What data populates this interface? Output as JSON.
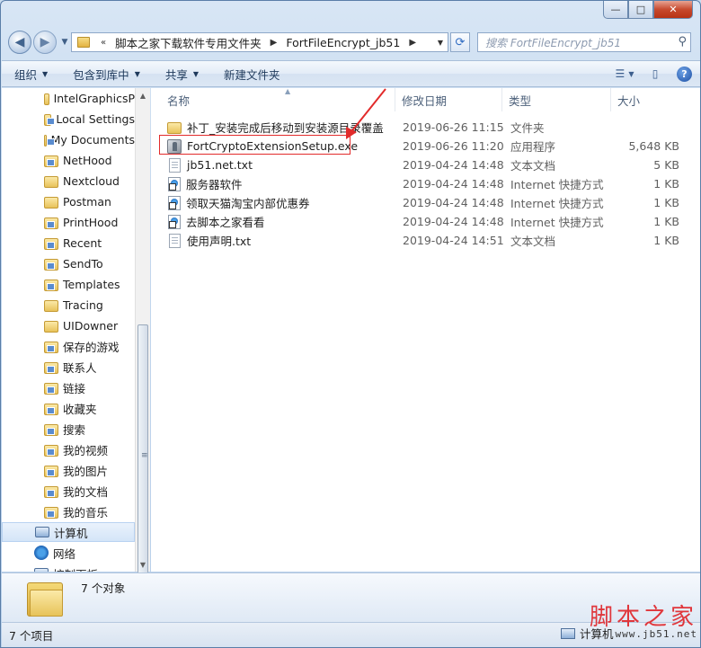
{
  "window": {
    "caption": {
      "minimize": "—",
      "maximize": "□",
      "close": "✕"
    }
  },
  "address": {
    "overflow": "«",
    "crumbs": [
      "脚本之家下载软件专用文件夹",
      "FortFileEncrypt_jb51"
    ],
    "search_placeholder": "搜索 FortFileEncrypt_jb51"
  },
  "toolbar": {
    "organize": "组织",
    "include_in_library": "包含到库中",
    "share": "共享",
    "new_folder": "新建文件夹"
  },
  "nav_tree": [
    {
      "label": "IntelGraphicsP",
      "icon": "folder-icon"
    },
    {
      "label": "Local Settings",
      "icon": "shortcut-folder-icon"
    },
    {
      "label": "My Documents",
      "icon": "shortcut-folder-icon"
    },
    {
      "label": "NetHood",
      "icon": "shortcut-folder-icon"
    },
    {
      "label": "Nextcloud",
      "icon": "folder-icon"
    },
    {
      "label": "Postman",
      "icon": "folder-icon"
    },
    {
      "label": "PrintHood",
      "icon": "shortcut-folder-icon"
    },
    {
      "label": "Recent",
      "icon": "shortcut-folder-icon"
    },
    {
      "label": "SendTo",
      "icon": "shortcut-folder-icon"
    },
    {
      "label": "Templates",
      "icon": "shortcut-folder-icon"
    },
    {
      "label": "Tracing",
      "icon": "folder-icon"
    },
    {
      "label": "UIDowner",
      "icon": "folder-icon"
    },
    {
      "label": "保存的游戏",
      "icon": "special-folder-icon"
    },
    {
      "label": "联系人",
      "icon": "special-folder-icon"
    },
    {
      "label": "链接",
      "icon": "special-folder-icon"
    },
    {
      "label": "收藏夹",
      "icon": "special-folder-icon"
    },
    {
      "label": "搜索",
      "icon": "special-folder-icon"
    },
    {
      "label": "我的视频",
      "icon": "special-folder-icon"
    },
    {
      "label": "我的图片",
      "icon": "special-folder-icon"
    },
    {
      "label": "我的文档",
      "icon": "special-folder-icon"
    },
    {
      "label": "我的音乐",
      "icon": "special-folder-icon"
    },
    {
      "label": "计算机",
      "icon": "computer-icon"
    },
    {
      "label": "网络",
      "icon": "network-icon"
    },
    {
      "label": "控制面板",
      "icon": "control-panel-icon"
    }
  ],
  "columns": {
    "name": "名称",
    "modified": "修改日期",
    "type": "类型",
    "size": "大小"
  },
  "files": [
    {
      "name": "补丁_安装完成后移动到安装源目录覆盖",
      "modified": "2019-06-26 11:15",
      "type": "文件夹",
      "size": "",
      "icon": "folder-icon"
    },
    {
      "name": "FortCryptoExtensionSetup.exe",
      "modified": "2019-06-26 11:20",
      "type": "应用程序",
      "size": "5,648 KB",
      "icon": "exe-icon"
    },
    {
      "name": "jb51.net.txt",
      "modified": "2019-04-24 14:48",
      "type": "文本文档",
      "size": "5 KB",
      "icon": "text-file-icon"
    },
    {
      "name": "服务器软件",
      "modified": "2019-04-24 14:48",
      "type": "Internet 快捷方式",
      "size": "1 KB",
      "icon": "internet-shortcut-icon"
    },
    {
      "name": "领取天猫淘宝内部优惠券",
      "modified": "2019-04-24 14:48",
      "type": "Internet 快捷方式",
      "size": "1 KB",
      "icon": "internet-shortcut-icon"
    },
    {
      "name": "去脚本之家看看",
      "modified": "2019-04-24 14:48",
      "type": "Internet 快捷方式",
      "size": "1 KB",
      "icon": "internet-shortcut-icon"
    },
    {
      "name": "使用声明.txt",
      "modified": "2019-04-24 14:51",
      "type": "文本文档",
      "size": "1 KB",
      "icon": "text-file-icon"
    }
  ],
  "details": {
    "object_count": "7 个对象"
  },
  "status": {
    "items": "7 个项目",
    "location": "计算机"
  },
  "watermark": {
    "text": "脚本之家",
    "url": "www.jb51.net"
  },
  "colors": {
    "highlight_box": "#e22b2b",
    "selection": "#e6effa"
  }
}
